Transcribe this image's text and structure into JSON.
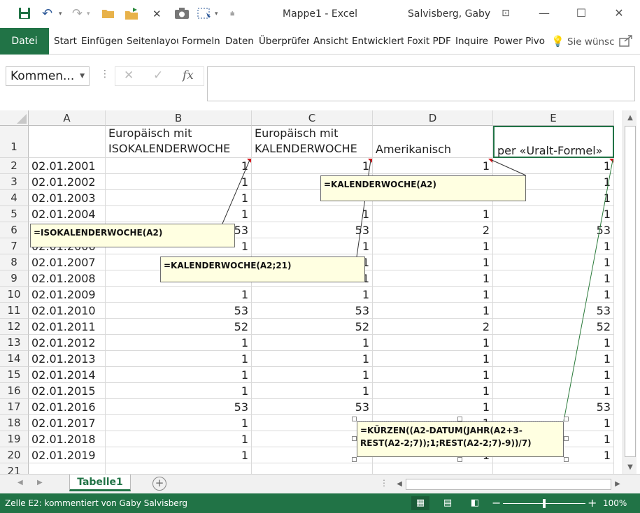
{
  "window": {
    "title": "Mappe1  -  Excel",
    "user": "Salvisberg, Gaby",
    "minimize": "—",
    "restore": "☐",
    "close": "✕",
    "ribbon_display": "⊡"
  },
  "quick_access": {
    "save_icon": "save-icon",
    "undo": "↶",
    "redo": "↷",
    "dropdown": "▾",
    "icons": [
      "save-icon",
      "undo-icon",
      "redo-icon",
      "open-folder-icon",
      "share-folder-icon",
      "cut-icon",
      "camera-icon",
      "select-icon",
      "customize-icon"
    ]
  },
  "ribbon": {
    "file_tab": "Datei",
    "tabs": [
      "Start",
      "Einfügen",
      "Seitenlayou",
      "Formeln",
      "Daten",
      "Überprüfer",
      "Ansicht",
      "Entwicklert",
      "Foxit PDF",
      "Inquire",
      "Power Pivo"
    ],
    "tell_me": "Sie wünsc",
    "accent": "#217346"
  },
  "formula_bar": {
    "name_box": "Kommen...",
    "cancel": "✕",
    "enter": "✓",
    "fx": "fx",
    "value": ""
  },
  "columns": [
    "A",
    "B",
    "C",
    "D",
    "E"
  ],
  "header_row": {
    "row": "1",
    "A": "",
    "B_line1": "Europäisch mit",
    "B_line2": "ISOKALENDERWOCHE",
    "C_line1": "Europäisch mit",
    "C_line2": "KALENDERWOCHE",
    "D": "Amerikanisch",
    "E": "per «Uralt-Formel»"
  },
  "rows": [
    {
      "row": "2",
      "A": "02.01.2001",
      "B": "1",
      "C": "1",
      "D": "1",
      "E": "1"
    },
    {
      "row": "3",
      "A": "02.01.2002",
      "B": "1",
      "C": "",
      "D": "",
      "E": "1"
    },
    {
      "row": "4",
      "A": "02.01.2003",
      "B": "1",
      "C": "",
      "D": "",
      "E": "1"
    },
    {
      "row": "5",
      "A": "02.01.2004",
      "B": "1",
      "C": "1",
      "D": "1",
      "E": "1"
    },
    {
      "row": "6",
      "A": "",
      "B": "53",
      "C": "53",
      "D": "2",
      "E": "53"
    },
    {
      "row": "7",
      "A": "02.01.2006",
      "B": "1",
      "C": "1",
      "D": "1",
      "E": "1"
    },
    {
      "row": "8",
      "A": "02.01.2007",
      "B": "",
      "C": "1",
      "D": "1",
      "E": "1"
    },
    {
      "row": "9",
      "A": "02.01.2008",
      "B": "",
      "C": "1",
      "D": "1",
      "E": "1"
    },
    {
      "row": "10",
      "A": "02.01.2009",
      "B": "1",
      "C": "1",
      "D": "1",
      "E": "1"
    },
    {
      "row": "11",
      "A": "02.01.2010",
      "B": "53",
      "C": "53",
      "D": "1",
      "E": "53"
    },
    {
      "row": "12",
      "A": "02.01.2011",
      "B": "52",
      "C": "52",
      "D": "2",
      "E": "52"
    },
    {
      "row": "13",
      "A": "02.01.2012",
      "B": "1",
      "C": "1",
      "D": "1",
      "E": "1"
    },
    {
      "row": "14",
      "A": "02.01.2013",
      "B": "1",
      "C": "1",
      "D": "1",
      "E": "1"
    },
    {
      "row": "15",
      "A": "02.01.2014",
      "B": "1",
      "C": "1",
      "D": "1",
      "E": "1"
    },
    {
      "row": "16",
      "A": "02.01.2015",
      "B": "1",
      "C": "1",
      "D": "1",
      "E": "1"
    },
    {
      "row": "17",
      "A": "02.01.2016",
      "B": "53",
      "C": "53",
      "D": "1",
      "E": "53"
    },
    {
      "row": "18",
      "A": "02.01.2017",
      "B": "1",
      "C": "",
      "D": "1",
      "E": "1"
    },
    {
      "row": "19",
      "A": "02.01.2018",
      "B": "1",
      "C": "",
      "D": "1",
      "E": "1"
    },
    {
      "row": "20",
      "A": "02.01.2019",
      "B": "1",
      "C": "",
      "D": "1",
      "E": "1"
    },
    {
      "row": "21",
      "A": "",
      "B": "",
      "C": "",
      "D": "",
      "E": ""
    }
  ],
  "comments": {
    "B": "=ISOKALENDERWOCHE(A2)",
    "C": "=KALENDERWOCHE(A2;21)",
    "D": "=KALENDERWOCHE(A2)",
    "E_line1": "=KÜRZEN((A2-DATUM(JAHR(A2+3-",
    "E_line2": "REST(A2-2;7));1;REST(A2-2;7)-9))/7)"
  },
  "sheet_tabs": {
    "active": "Tabelle1",
    "add": "+"
  },
  "status": {
    "text": "Zelle E2: kommentiert von Gaby Salvisberg",
    "zoom": "100%",
    "zoom_fraction": 1.0
  }
}
